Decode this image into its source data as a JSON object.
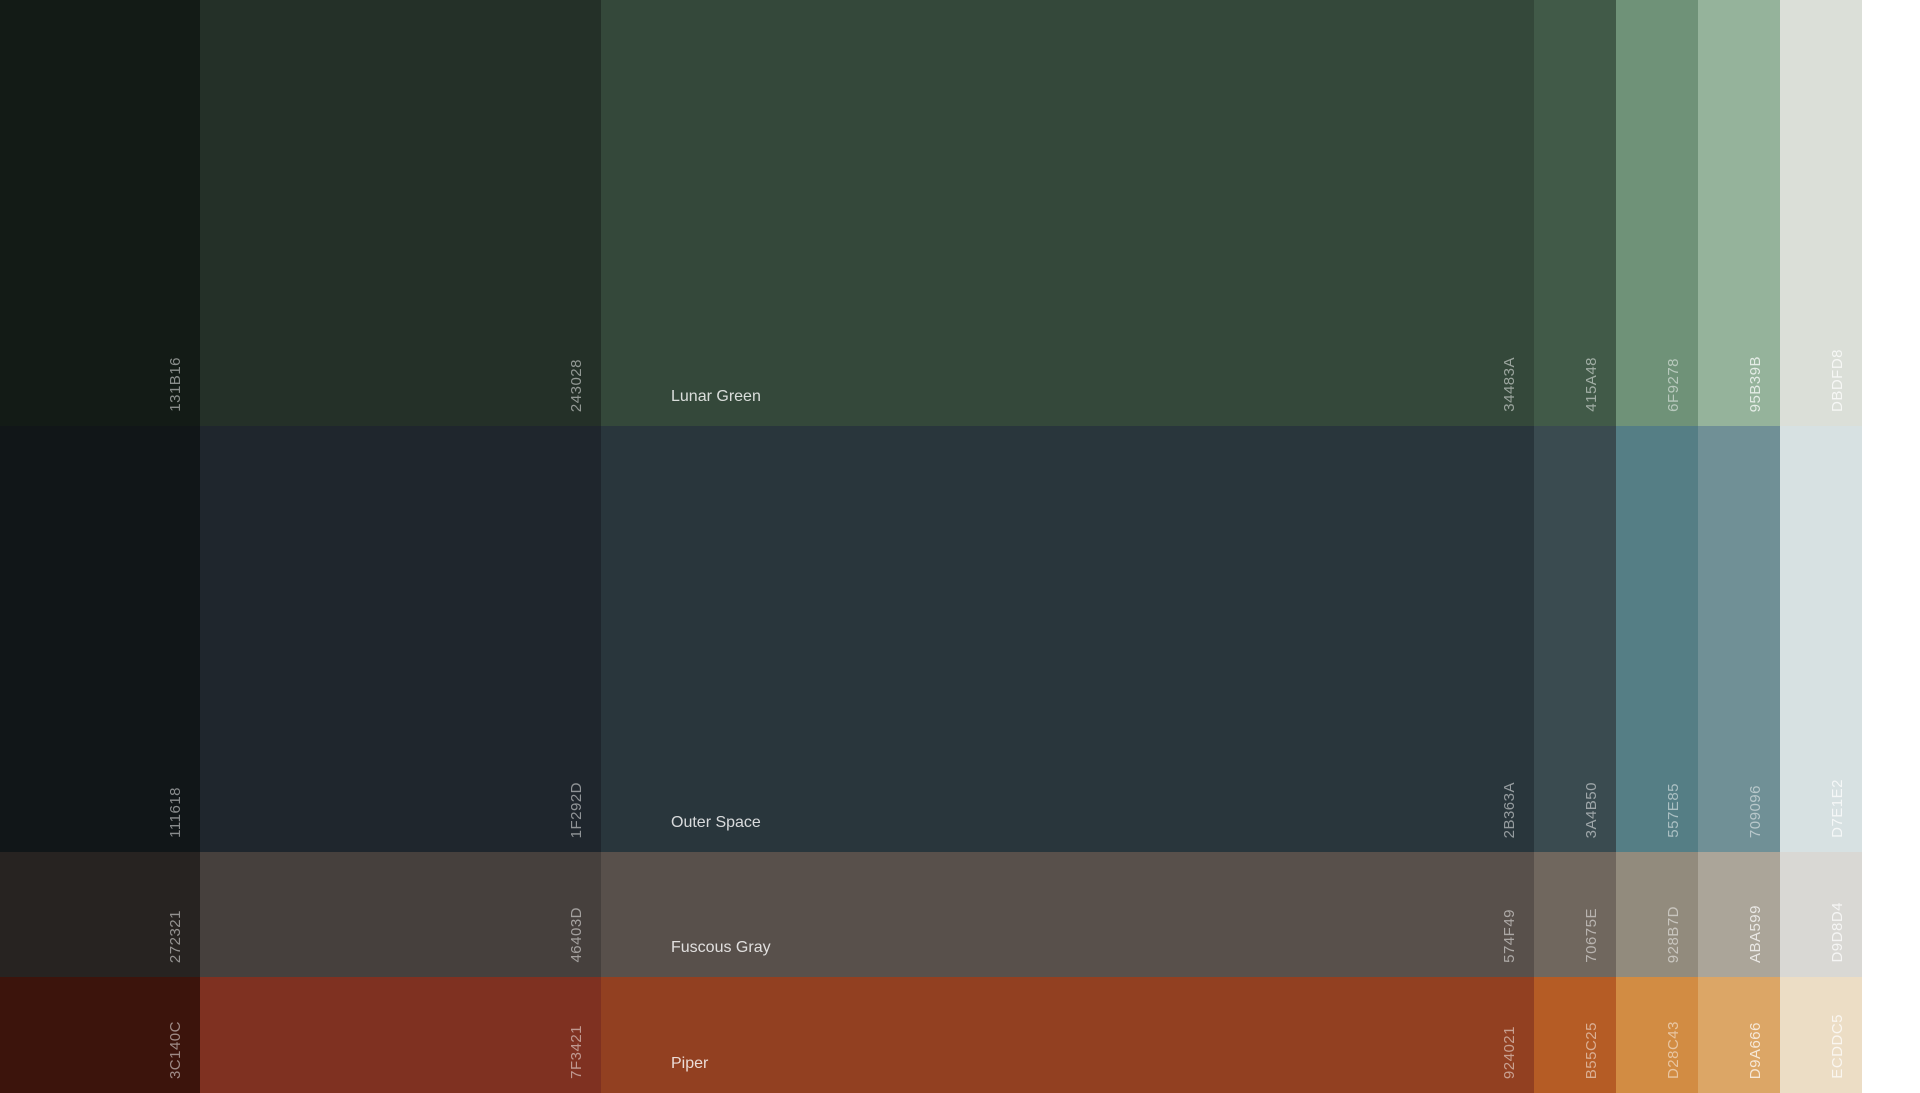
{
  "rows": [
    {
      "name": "Lunar Green",
      "swatches": [
        {
          "hex": "131B16",
          "color": "#131B16"
        },
        {
          "hex": "243028",
          "color": "#243028"
        },
        {
          "hex": "34483A",
          "color": "#34483A"
        },
        {
          "hex": "415A48",
          "color": "#415A48"
        },
        {
          "hex": "6F9278",
          "color": "#6F9278"
        },
        {
          "hex": "95B39B",
          "color": "#95B39B"
        },
        {
          "hex": "DBDFD8",
          "color": "#DBDFD8"
        }
      ]
    },
    {
      "name": "Outer Space",
      "swatches": [
        {
          "hex": "111618",
          "color": "#111618"
        },
        {
          "hex": "1F292D",
          "color": "#1F262D"
        },
        {
          "hex": "2B363A",
          "color": "#29363C"
        },
        {
          "hex": "3A4B50",
          "color": "#3A4B50"
        },
        {
          "hex": "557E85",
          "color": "#557E85"
        },
        {
          "hex": "709096",
          "color": "#709096"
        },
        {
          "hex": "D7E1E2",
          "color": "#D7E1E2"
        }
      ]
    },
    {
      "name": "Fuscous Gray",
      "swatches": [
        {
          "hex": "272321",
          "color": "#272321"
        },
        {
          "hex": "46403D",
          "color": "#46403D"
        },
        {
          "hex": "574F49",
          "color": "#58504B"
        },
        {
          "hex": "70675E",
          "color": "#70675E"
        },
        {
          "hex": "928B7D",
          "color": "#928B7D"
        },
        {
          "hex": "ABA599",
          "color": "#ABA599"
        },
        {
          "hex": "D9D8D4",
          "color": "#D9D8D4"
        }
      ]
    },
    {
      "name": "Piper",
      "swatches": [
        {
          "hex": "3C140C",
          "color": "#3C140C"
        },
        {
          "hex": "7F3421",
          "color": "#7F3121"
        },
        {
          "hex": "924021",
          "color": "#924021"
        },
        {
          "hex": "B55C25",
          "color": "#B55C25"
        },
        {
          "hex": "D28C43",
          "color": "#D28C43"
        },
        {
          "hex": "D9A666",
          "color": "#DCA666"
        },
        {
          "hex": "ECDDC5",
          "color": "#ECDDC5"
        }
      ]
    }
  ]
}
